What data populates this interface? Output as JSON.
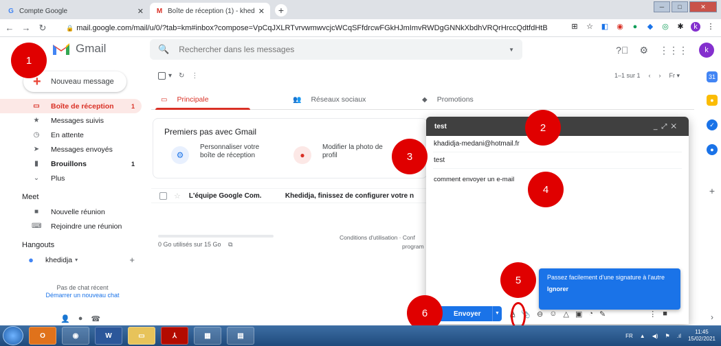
{
  "browser": {
    "tabs": [
      {
        "title": "Compte Google",
        "favicon": "G"
      },
      {
        "title": "Boîte de réception (1) - khedidja",
        "favicon": "M"
      }
    ],
    "url": "mail.google.com/mail/u/0/?tab=km#inbox?compose=VpCqJXLRTvrvwmwvcjcWCqSFfdrcwFGkHJmImvRWDgGNNkXbdhVRQrHrccQdtfdHtBQ...",
    "profile_letter": "k"
  },
  "header": {
    "app_name": "Gmail",
    "search_placeholder": "Rechercher dans les messages",
    "avatar_letter": "k"
  },
  "sidebar": {
    "compose_label": "Nouveau message",
    "items": [
      {
        "label": "Boîte de réception",
        "count": "1",
        "icon": "inbox-icon",
        "glyph": "▭"
      },
      {
        "label": "Messages suivis",
        "count": "",
        "icon": "star-icon",
        "glyph": "★"
      },
      {
        "label": "En attente",
        "count": "",
        "icon": "clock-icon",
        "glyph": "◷"
      },
      {
        "label": "Messages envoyés",
        "count": "",
        "icon": "send-icon",
        "glyph": "➤"
      },
      {
        "label": "Brouillons",
        "count": "1",
        "icon": "draft-icon",
        "glyph": "▮"
      },
      {
        "label": "Plus",
        "count": "",
        "icon": "chevron-down-icon",
        "glyph": "⌄"
      }
    ],
    "meet_heading": "Meet",
    "meet_items": [
      "Nouvelle réunion",
      "Rejoindre une réunion"
    ],
    "hangouts_heading": "Hangouts",
    "hangouts_user": "khedidja",
    "no_chat": "Pas de chat récent",
    "start_chat": "Démarrer un nouveau chat"
  },
  "main": {
    "pager_text": "1–1 sur 1",
    "lang_short": "Fr",
    "tabs": [
      "Principale",
      "Réseaux sociaux",
      "Promotions"
    ],
    "getting_started_title": "Premiers pas avec Gmail",
    "card1": "Personnaliser votre boîte de réception",
    "card2": "Modifier la photo de profil",
    "row_from": "L'équipe Google Com.",
    "row_subject": "Khedidja, finissez de configurer votre n",
    "storage_used": "0 Go utilisés sur 15 Go",
    "terms": "Conditions d'utilisation · Conf",
    "program": "program"
  },
  "compose": {
    "title": "test",
    "to": "khadidja-medani@hotmail.fr",
    "subject": "test",
    "body": "comment envoyer un e-mail",
    "send_label": "Envoyer"
  },
  "tooltip": {
    "text": "Passez facilement d'une signature à l'autre",
    "dismiss": "Ignorer"
  },
  "markers": [
    "1",
    "2",
    "3",
    "4",
    "5",
    "6"
  ],
  "taskbar": {
    "lang": "FR",
    "time": "11:45",
    "date": "15/02/2021"
  },
  "colors": {
    "gmail_red": "#d93025",
    "accent_blue": "#1a73e8",
    "marker_red": "#e00000"
  }
}
